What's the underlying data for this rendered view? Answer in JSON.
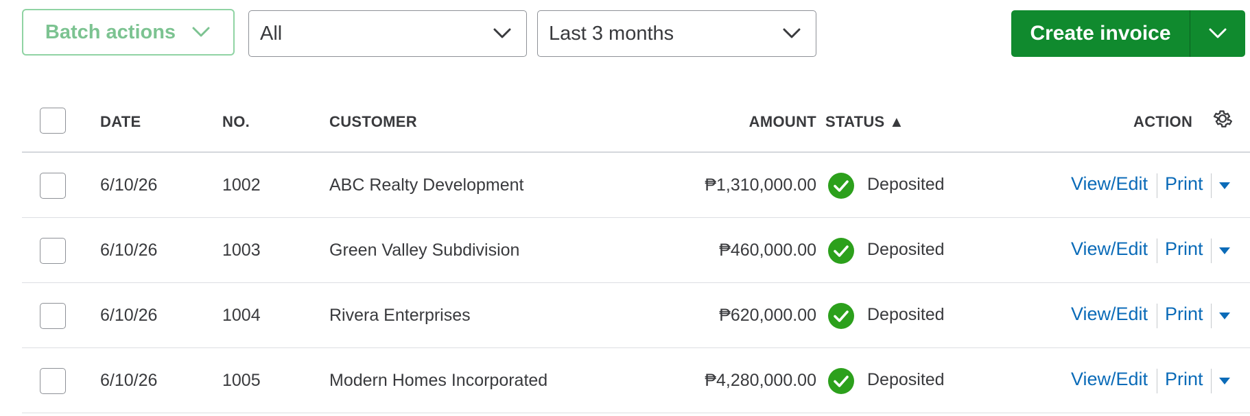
{
  "toolbar": {
    "batch_actions_label": "Batch actions",
    "type_filter_value": "All",
    "date_filter_value": "Last 3 months",
    "create_invoice_label": "Create invoice"
  },
  "table": {
    "headers": {
      "date": "DATE",
      "no": "NO.",
      "customer": "CUSTOMER",
      "amount": "AMOUNT",
      "status": "STATUS ▲",
      "action": "ACTION"
    },
    "rows": [
      {
        "date": "6/10/26",
        "no": "1002",
        "customer": "ABC Realty Development",
        "amount": "₱1,310,000.00",
        "status": "Deposited",
        "view": "View/Edit",
        "print": "Print"
      },
      {
        "date": "6/10/26",
        "no": "1003",
        "customer": "Green Valley Subdivision",
        "amount": "₱460,000.00",
        "status": "Deposited",
        "view": "View/Edit",
        "print": "Print"
      },
      {
        "date": "6/10/26",
        "no": "1004",
        "customer": "Rivera Enterprises",
        "amount": "₱620,000.00",
        "status": "Deposited",
        "view": "View/Edit",
        "print": "Print"
      },
      {
        "date": "6/10/26",
        "no": "1005",
        "customer": "Modern Homes Incorporated",
        "amount": "₱4,280,000.00",
        "status": "Deposited",
        "view": "View/Edit",
        "print": "Print"
      }
    ]
  },
  "colors": {
    "brand_green": "#108a2e",
    "status_green": "#2ca01c",
    "link_blue": "#0b6bb8",
    "batch_green": "#7cc391"
  },
  "icons": {
    "dropdown": "chevron-down-icon",
    "settings": "gear-icon",
    "status": "check-circle-icon",
    "row_menu": "caret-down-icon"
  }
}
